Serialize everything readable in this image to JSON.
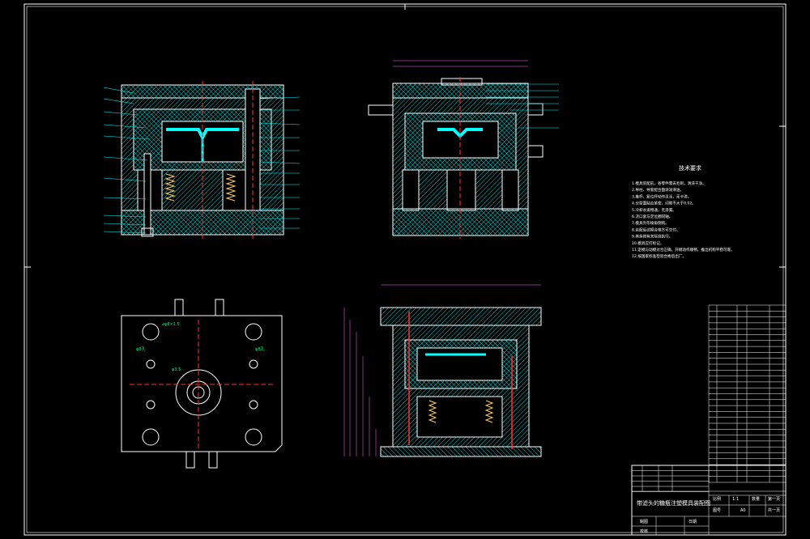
{
  "drawing": {
    "tech_notes_title": "技术要求",
    "tech_notes": [
      "1.模具装配前，各零件需去毛刺，清洗干净。",
      "2.导柱、导套配合面涂润滑油。",
      "3.推杆、复位杆动作灵活，无卡滞。",
      "4.分型面贴合紧密，间隙不大于0.02。",
      "5.冷却水道畅通，无渗漏。",
      "6.浇口套与定位圈同轴。",
      "7.模具外形棱角倒钝。",
      "8.装配后试模合格方可交付。",
      "9.其余按有关标准执行。",
      "10.模具应打标记。",
      "11.定模与动模对合正确，开模动作顺畅，推出机构平稳可靠。",
      "12.按国家标准检验合格后出厂。"
    ],
    "title_block": {
      "name": "带滤头的糖瓶注塑模具装配图",
      "scale_label": "比例",
      "scale": "1:1",
      "qty_label": "数量",
      "sheet": "第一页",
      "drawing_no_label": "图号",
      "format": "A0",
      "total": "共一页",
      "drawn_label": "制图",
      "checked_label": "校核",
      "date_label": "日期"
    }
  },
  "colors": {
    "border": "#ffffff",
    "hatch": "#00ffff",
    "leader": "#00ffff",
    "center": "#ff3333",
    "text_green": "#00ff66",
    "dimension": "#ff66ff"
  }
}
